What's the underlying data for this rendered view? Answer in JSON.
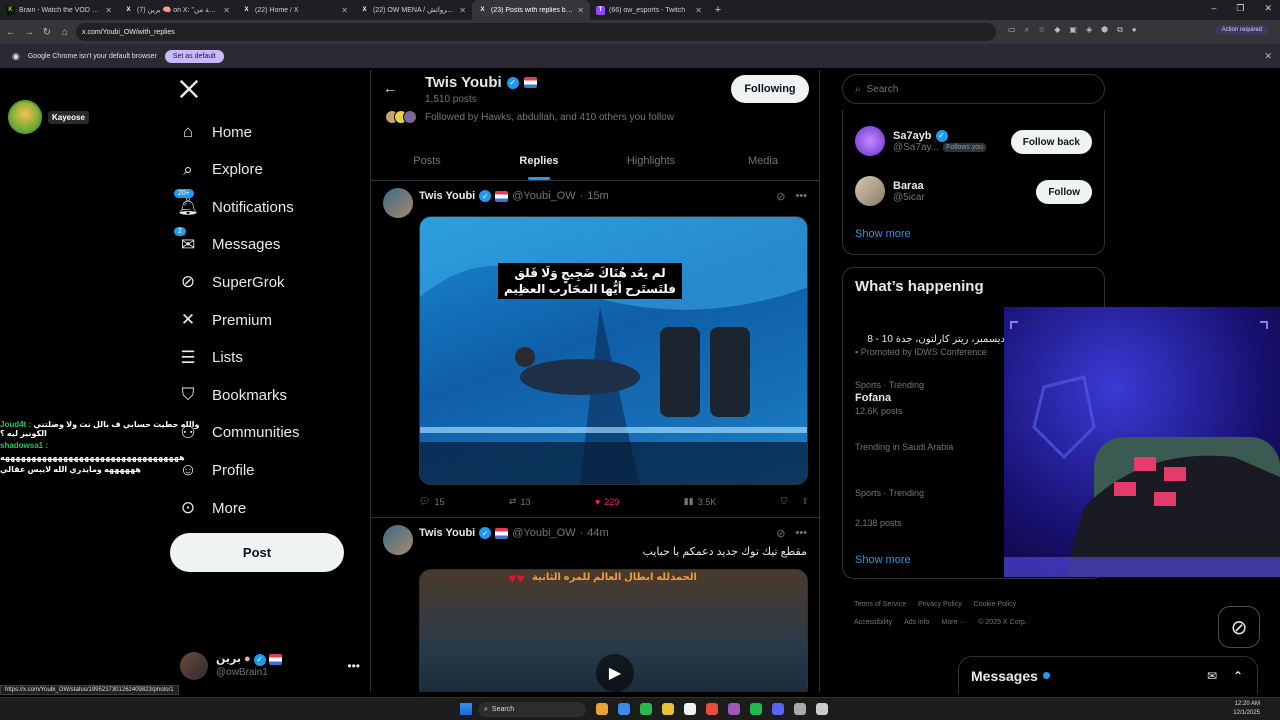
{
  "browser": {
    "tabs": [
      {
        "title": "Brain - Watch the VOD on Kick",
        "icon": "kick-icon",
        "color": "#53fc18",
        "active": false
      },
      {
        "title": "(7) برين 🧠 on X: \"لقطة من",
        "icon": "x-icon",
        "color": "#ffffff",
        "active": false
      },
      {
        "title": "(22) Home / X",
        "icon": "x-icon",
        "color": "#ffffff",
        "active": false
      },
      {
        "title": "(22) OW MENA / ذات اوفرواتش",
        "icon": "x-icon",
        "color": "#ffffff",
        "active": false
      },
      {
        "title": "(23) Posts with replies by Twis",
        "icon": "x-icon",
        "color": "#ffffff",
        "active": true
      },
      {
        "title": "(66) ow_esports - Twitch",
        "icon": "twitch-icon",
        "color": "#9146ff",
        "active": false
      }
    ],
    "url": "x.com/Youbi_OW/with_replies",
    "action_required": "Action required",
    "infobar_text": "Google Chrome isn't your default browser",
    "set_default_label": "Set as default",
    "status_url": "https://x.com/Youbi_OW/status/1995237301262409823/photo/1"
  },
  "stream": {
    "streamer_name": "Kayeose",
    "chat": [
      {
        "user": "Joud4t",
        "user_color": "#22c55e",
        "text": "والله حطيت حسابي ف بالل نت ولا وصلتني الكونيز ليه ؟"
      },
      {
        "user": "shadowsa1",
        "user_color": "#22c55e",
        "text": ""
      },
      {
        "user": "",
        "user_color": "#ffffff",
        "text": "ههههههههههههههههههههههههههههههههههه"
      },
      {
        "user": "",
        "user_color": "#ffffff",
        "text": "ههههههه ومايدري الله لايبس عقالي"
      }
    ]
  },
  "nav": {
    "items": [
      {
        "label": "Home",
        "icon": "home-icon",
        "badge": ""
      },
      {
        "label": "Explore",
        "icon": "search-icon",
        "badge": ""
      },
      {
        "label": "Notifications",
        "icon": "bell-icon",
        "badge": "20+"
      },
      {
        "label": "Messages",
        "icon": "envelope-icon",
        "badge": "2"
      },
      {
        "label": "SuperGrok",
        "icon": "grok-icon",
        "badge": ""
      },
      {
        "label": "Premium",
        "icon": "x-logo-icon",
        "badge": ""
      },
      {
        "label": "Lists",
        "icon": "list-icon",
        "badge": ""
      },
      {
        "label": "Bookmarks",
        "icon": "bookmark-icon",
        "badge": ""
      },
      {
        "label": "Communities",
        "icon": "communities-icon",
        "badge": ""
      },
      {
        "label": "Profile",
        "icon": "person-icon",
        "badge": ""
      },
      {
        "label": "More",
        "icon": "more-circle-icon",
        "badge": ""
      }
    ],
    "post_label": "Post",
    "account": {
      "name": "برين",
      "handle": "@owBrain1"
    }
  },
  "profile": {
    "name": "Twis Youbi",
    "posts_count": "1,510 posts",
    "followed_by": "Followed by Hawks, abdullah, and 410 others you follow",
    "following_label": "Following",
    "tabs": [
      "Posts",
      "Replies",
      "Highlights",
      "Media"
    ],
    "active_tab": 1
  },
  "tweets": [
    {
      "name": "Twis Youbi",
      "handle": "@Youbi_OW",
      "time": "15m",
      "text": "",
      "caption": "لم يعُد هُنَاكَ ضَجِيجٍ وَلَا قَلق\nفلتَستَرح أيُّها المحَارب العظِيم",
      "stats": {
        "replies": "15",
        "reposts": "13",
        "likes": "229",
        "views": "3.5K"
      }
    },
    {
      "name": "Twis Youbi",
      "handle": "@Youbi_OW",
      "time": "44m",
      "text": "مقطع تيك توك جديد دعمكم يا حبايب",
      "caption": "الحمدلله ابطال العالم للمره الثانية"
    }
  ],
  "sidebar": {
    "search_placeholder": "Search",
    "who_to_follow": [
      {
        "name": "Sa7ayb",
        "handle": "@Sa7ay...",
        "follows_you": "Follows you",
        "button": "Follow back"
      },
      {
        "name": "Baraa",
        "handle": "@5icar",
        "follows_you": "",
        "button": "Follow"
      }
    ],
    "show_more": "Show more",
    "whats_happening_title": "What’s happening",
    "trends": [
      {
        "context": "",
        "title": "ديسمبر، ريتز كارلتون، جدة 10 - 8",
        "meta": "Promoted by IDWS Conference"
      },
      {
        "context": "Sports · Trending",
        "title": "Fofana",
        "meta": "12.6K posts"
      },
      {
        "context": "Trending in Saudi Arabia",
        "title": "",
        "meta": ""
      },
      {
        "context": "Sports · Trending",
        "title": "",
        "meta": "2,138 posts"
      }
    ],
    "show_more_2": "Show more",
    "footer": [
      "Terms of Service",
      "Privacy Policy",
      "Cookie Policy",
      "Accessibility",
      "Ads info",
      "More ···",
      "© 2025 X Corp."
    ]
  },
  "messages_drawer": {
    "title": "Messages"
  },
  "taskbar": {
    "search": "Search",
    "time": "12:20 AM",
    "date": "12/1/2025"
  },
  "colors": {
    "accent": "#1d9bf0",
    "like": "#f91880",
    "bg": "#000000",
    "border": "#2f3336"
  }
}
